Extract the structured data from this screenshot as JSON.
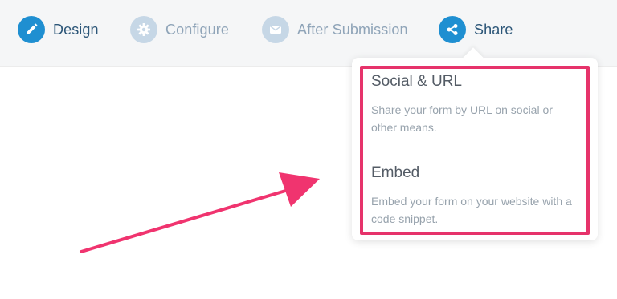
{
  "nav": {
    "items": [
      {
        "label": "Design",
        "icon": "pencil-icon",
        "state": "completed"
      },
      {
        "label": "Configure",
        "icon": "gear-icon",
        "state": "inactive"
      },
      {
        "label": "After Submission",
        "icon": "envelope-icon",
        "state": "inactive"
      },
      {
        "label": "Share",
        "icon": "share-icon",
        "state": "active"
      }
    ]
  },
  "share_menu": {
    "options": [
      {
        "title": "Social & URL",
        "description": "Share your form by URL on social or other means."
      },
      {
        "title": "Embed",
        "description": "Embed your form on your website with a code snippet."
      }
    ]
  },
  "colors": {
    "accent": "#1f8fd1",
    "highlight": "#e6336b",
    "arrow": "#f0346f"
  }
}
